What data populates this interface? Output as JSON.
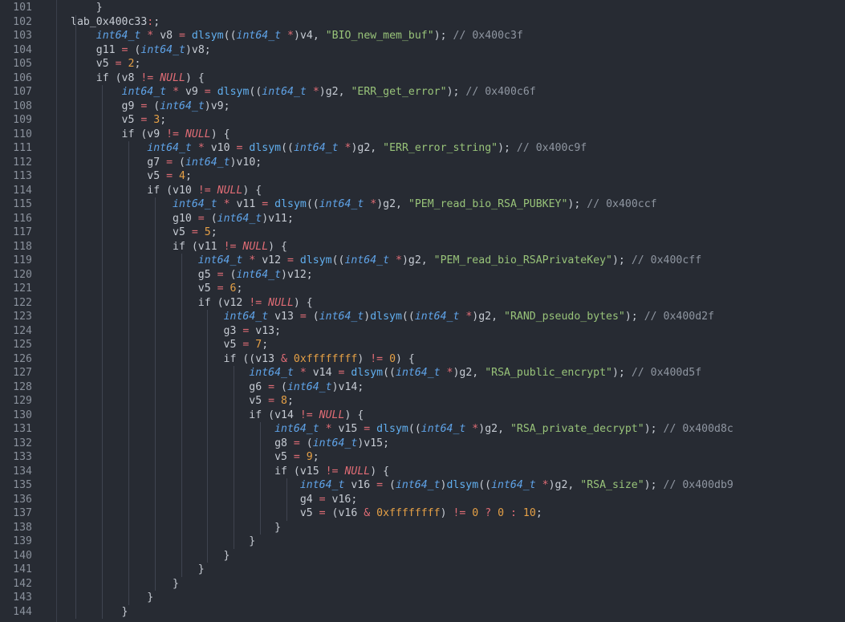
{
  "editor": {
    "title": "decompiled-code-view",
    "lines": [
      {
        "n": "101",
        "code": "    }"
      },
      {
        "n": "102",
        "code": "lab_0x400c33:;"
      },
      {
        "n": "103",
        "code": "    int64_t * v8 = dlsym((int64_t *)v4, \"BIO_new_mem_buf\"); // 0x400c3f"
      },
      {
        "n": "104",
        "code": "    g11 = (int64_t)v8;"
      },
      {
        "n": "105",
        "code": "    v5 = 2;"
      },
      {
        "n": "106",
        "code": "    if (v8 != NULL) {"
      },
      {
        "n": "107",
        "code": "        int64_t * v9 = dlsym((int64_t *)g2, \"ERR_get_error\"); // 0x400c6f"
      },
      {
        "n": "108",
        "code": "        g9 = (int64_t)v9;"
      },
      {
        "n": "109",
        "code": "        v5 = 3;"
      },
      {
        "n": "110",
        "code": "        if (v9 != NULL) {"
      },
      {
        "n": "111",
        "code": "            int64_t * v10 = dlsym((int64_t *)g2, \"ERR_error_string\"); // 0x400c9f"
      },
      {
        "n": "112",
        "code": "            g7 = (int64_t)v10;"
      },
      {
        "n": "113",
        "code": "            v5 = 4;"
      },
      {
        "n": "114",
        "code": "            if (v10 != NULL) {"
      },
      {
        "n": "115",
        "code": "                int64_t * v11 = dlsym((int64_t *)g2, \"PEM_read_bio_RSA_PUBKEY\"); // 0x400ccf"
      },
      {
        "n": "116",
        "code": "                g10 = (int64_t)v11;"
      },
      {
        "n": "117",
        "code": "                v5 = 5;"
      },
      {
        "n": "118",
        "code": "                if (v11 != NULL) {"
      },
      {
        "n": "119",
        "code": "                    int64_t * v12 = dlsym((int64_t *)g2, \"PEM_read_bio_RSAPrivateKey\"); // 0x400cff"
      },
      {
        "n": "120",
        "code": "                    g5 = (int64_t)v12;"
      },
      {
        "n": "121",
        "code": "                    v5 = 6;"
      },
      {
        "n": "122",
        "code": "                    if (v12 != NULL) {"
      },
      {
        "n": "123",
        "code": "                        int64_t v13 = (int64_t)dlsym((int64_t *)g2, \"RAND_pseudo_bytes\"); // 0x400d2f"
      },
      {
        "n": "124",
        "code": "                        g3 = v13;"
      },
      {
        "n": "125",
        "code": "                        v5 = 7;"
      },
      {
        "n": "126",
        "code": "                        if ((v13 & 0xffffffff) != 0) {"
      },
      {
        "n": "127",
        "code": "                            int64_t * v14 = dlsym((int64_t *)g2, \"RSA_public_encrypt\"); // 0x400d5f"
      },
      {
        "n": "128",
        "code": "                            g6 = (int64_t)v14;"
      },
      {
        "n": "129",
        "code": "                            v5 = 8;"
      },
      {
        "n": "130",
        "code": "                            if (v14 != NULL) {"
      },
      {
        "n": "131",
        "code": "                                int64_t * v15 = dlsym((int64_t *)g2, \"RSA_private_decrypt\"); // 0x400d8c"
      },
      {
        "n": "132",
        "code": "                                g8 = (int64_t)v15;"
      },
      {
        "n": "133",
        "code": "                                v5 = 9;"
      },
      {
        "n": "134",
        "code": "                                if (v15 != NULL) {"
      },
      {
        "n": "135",
        "code": "                                    int64_t v16 = (int64_t)dlsym((int64_t *)g2, \"RSA_size\"); // 0x400db9"
      },
      {
        "n": "136",
        "code": "                                    g4 = v16;"
      },
      {
        "n": "137",
        "code": "                                    v5 = (v16 & 0xffffffff) != 0 ? 0 : 10;"
      },
      {
        "n": "138",
        "code": "                                }"
      },
      {
        "n": "139",
        "code": "                            }"
      },
      {
        "n": "140",
        "code": "                        }"
      },
      {
        "n": "141",
        "code": "                    }"
      },
      {
        "n": "142",
        "code": "                }"
      },
      {
        "n": "143",
        "code": "            }"
      },
      {
        "n": "144",
        "code": "        }"
      }
    ]
  },
  "colors": {
    "background": "#272b33",
    "text": "#c6cbd3",
    "type": "#5fa3e8",
    "string": "#98c379",
    "number": "#e5a046",
    "keyword": "#e06c75",
    "comment": "#8f96a1",
    "line_number": "#8a919c"
  }
}
